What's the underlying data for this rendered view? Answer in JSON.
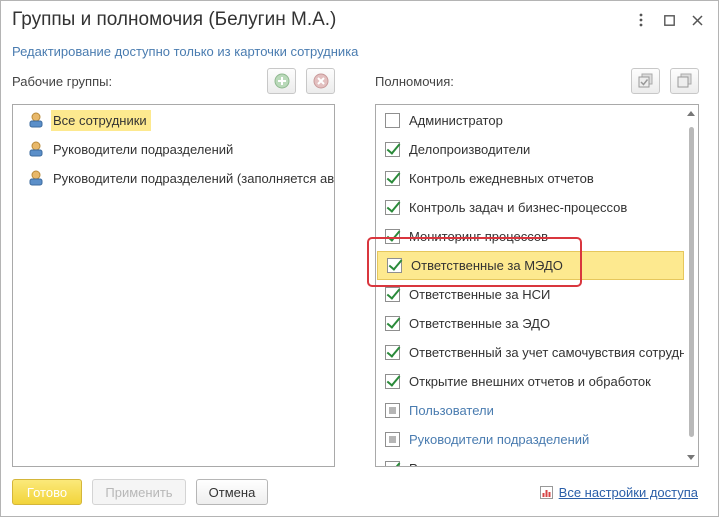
{
  "window": {
    "title": "Группы и полномочия (Белугин М.А.)",
    "more_icon": "more-vertical-icon",
    "maximize_icon": "maximize-icon",
    "close_icon": "close-icon"
  },
  "info": "Редактирование доступно только из карточки сотрудника",
  "groups": {
    "label": "Рабочие группы:",
    "add_icon": "add-icon",
    "remove_icon": "remove-icon",
    "items": [
      {
        "label": "Все сотрудники",
        "selected": true
      },
      {
        "label": "Руководители подразделений",
        "selected": false
      },
      {
        "label": "Руководители подразделений (заполняется автоматически)",
        "selected": false
      }
    ]
  },
  "permissions": {
    "label": "Полномочия:",
    "check_all_icon": "check-all-icon",
    "uncheck_all_icon": "uncheck-all-icon",
    "items": [
      {
        "label": "Администратор",
        "state": "unchecked"
      },
      {
        "label": "Делопроизводители",
        "state": "checked"
      },
      {
        "label": "Контроль ежедневных отчетов",
        "state": "checked"
      },
      {
        "label": "Контроль задач и бизнес-процессов",
        "state": "checked"
      },
      {
        "label": "Мониторинг процессов",
        "state": "checked"
      },
      {
        "label": "Ответственные за МЭДО",
        "state": "checked",
        "selected": true
      },
      {
        "label": "Ответственные за НСИ",
        "state": "checked"
      },
      {
        "label": "Ответственные за ЭДО",
        "state": "checked"
      },
      {
        "label": "Ответственный за учет самочувствия сотрудников",
        "state": "checked"
      },
      {
        "label": "Открытие внешних отчетов и обработок",
        "state": "checked"
      },
      {
        "label": "Пользователи",
        "state": "partial",
        "link": true
      },
      {
        "label": "Руководители подразделений",
        "state": "partial",
        "link": true
      },
      {
        "label": "Руководители проектов",
        "state": "checked"
      }
    ]
  },
  "footer": {
    "ok": "Готово",
    "apply": "Применить",
    "cancel": "Отмена",
    "access_settings": "Все настройки доступа",
    "access_icon": "report-icon"
  },
  "colors": {
    "accent_yellow": "#fde98f",
    "link_blue": "#4a7cb0",
    "highlight_red": "#d9363e",
    "check_green": "#2a8a3a"
  }
}
